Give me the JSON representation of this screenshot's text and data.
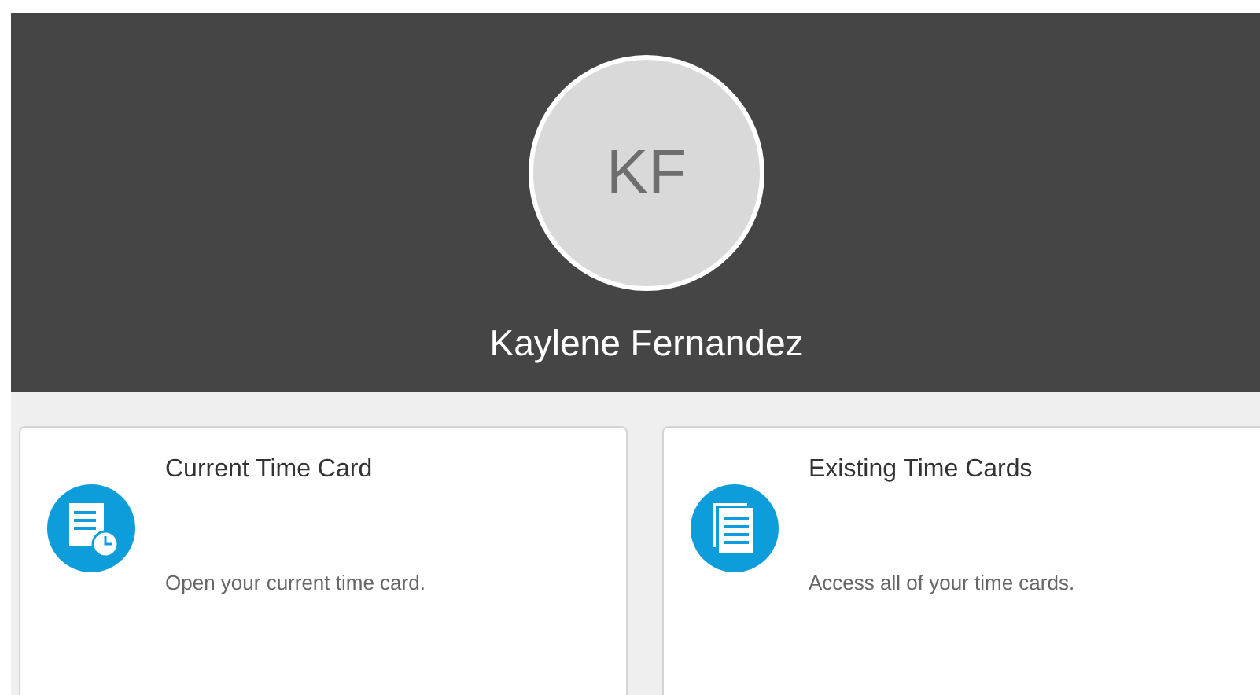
{
  "profile": {
    "initials": "KF",
    "name": "Kaylene Fernandez"
  },
  "cards": [
    {
      "kind": "current",
      "title": "Current Time Card",
      "description": "Open your current time card."
    },
    {
      "kind": "existing",
      "title": "Existing Time Cards",
      "description": "Access all of your time cards."
    }
  ]
}
